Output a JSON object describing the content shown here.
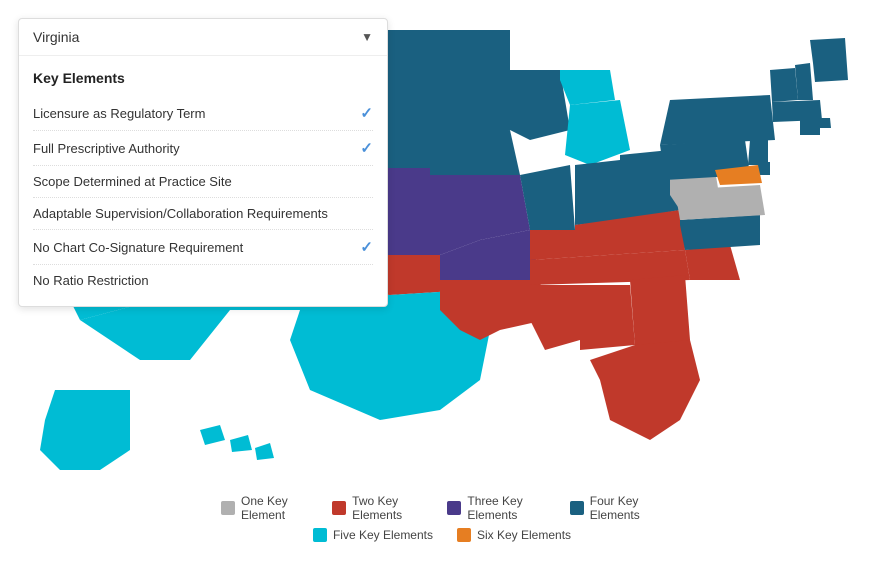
{
  "dropdown": {
    "selected_state": "Virginia",
    "arrow": "▼"
  },
  "key_elements": {
    "title": "Key Elements",
    "items": [
      {
        "label": "Licensure as Regulatory Term",
        "checked": true
      },
      {
        "label": "Full Prescriptive Authority",
        "checked": true
      },
      {
        "label": "Scope Determined at Practice Site",
        "checked": false
      },
      {
        "label": "Adaptable Supervision/Collaboration Requirements",
        "checked": false
      },
      {
        "label": "No Chart Co-Signature Requirement",
        "checked": true
      },
      {
        "label": "No Ratio Restriction",
        "checked": false
      }
    ]
  },
  "legend": {
    "rows": [
      [
        {
          "label": "One Key Element",
          "color": "#b0b0b0"
        },
        {
          "label": "Two Key Elements",
          "color": "#c0392b"
        },
        {
          "label": "Three Key Elements",
          "color": "#4a3a8a"
        },
        {
          "label": "Four Key Elements",
          "color": "#1a6080"
        }
      ],
      [
        {
          "label": "Five Key Elements",
          "color": "#00bcd4"
        },
        {
          "label": "Six Key Elements",
          "color": "#e67e22"
        }
      ]
    ]
  },
  "colors": {
    "one": "#b0b0b0",
    "two": "#c0392b",
    "three": "#4a3a8a",
    "four": "#1a6080",
    "five": "#00bcd4",
    "six": "#e67e22"
  }
}
